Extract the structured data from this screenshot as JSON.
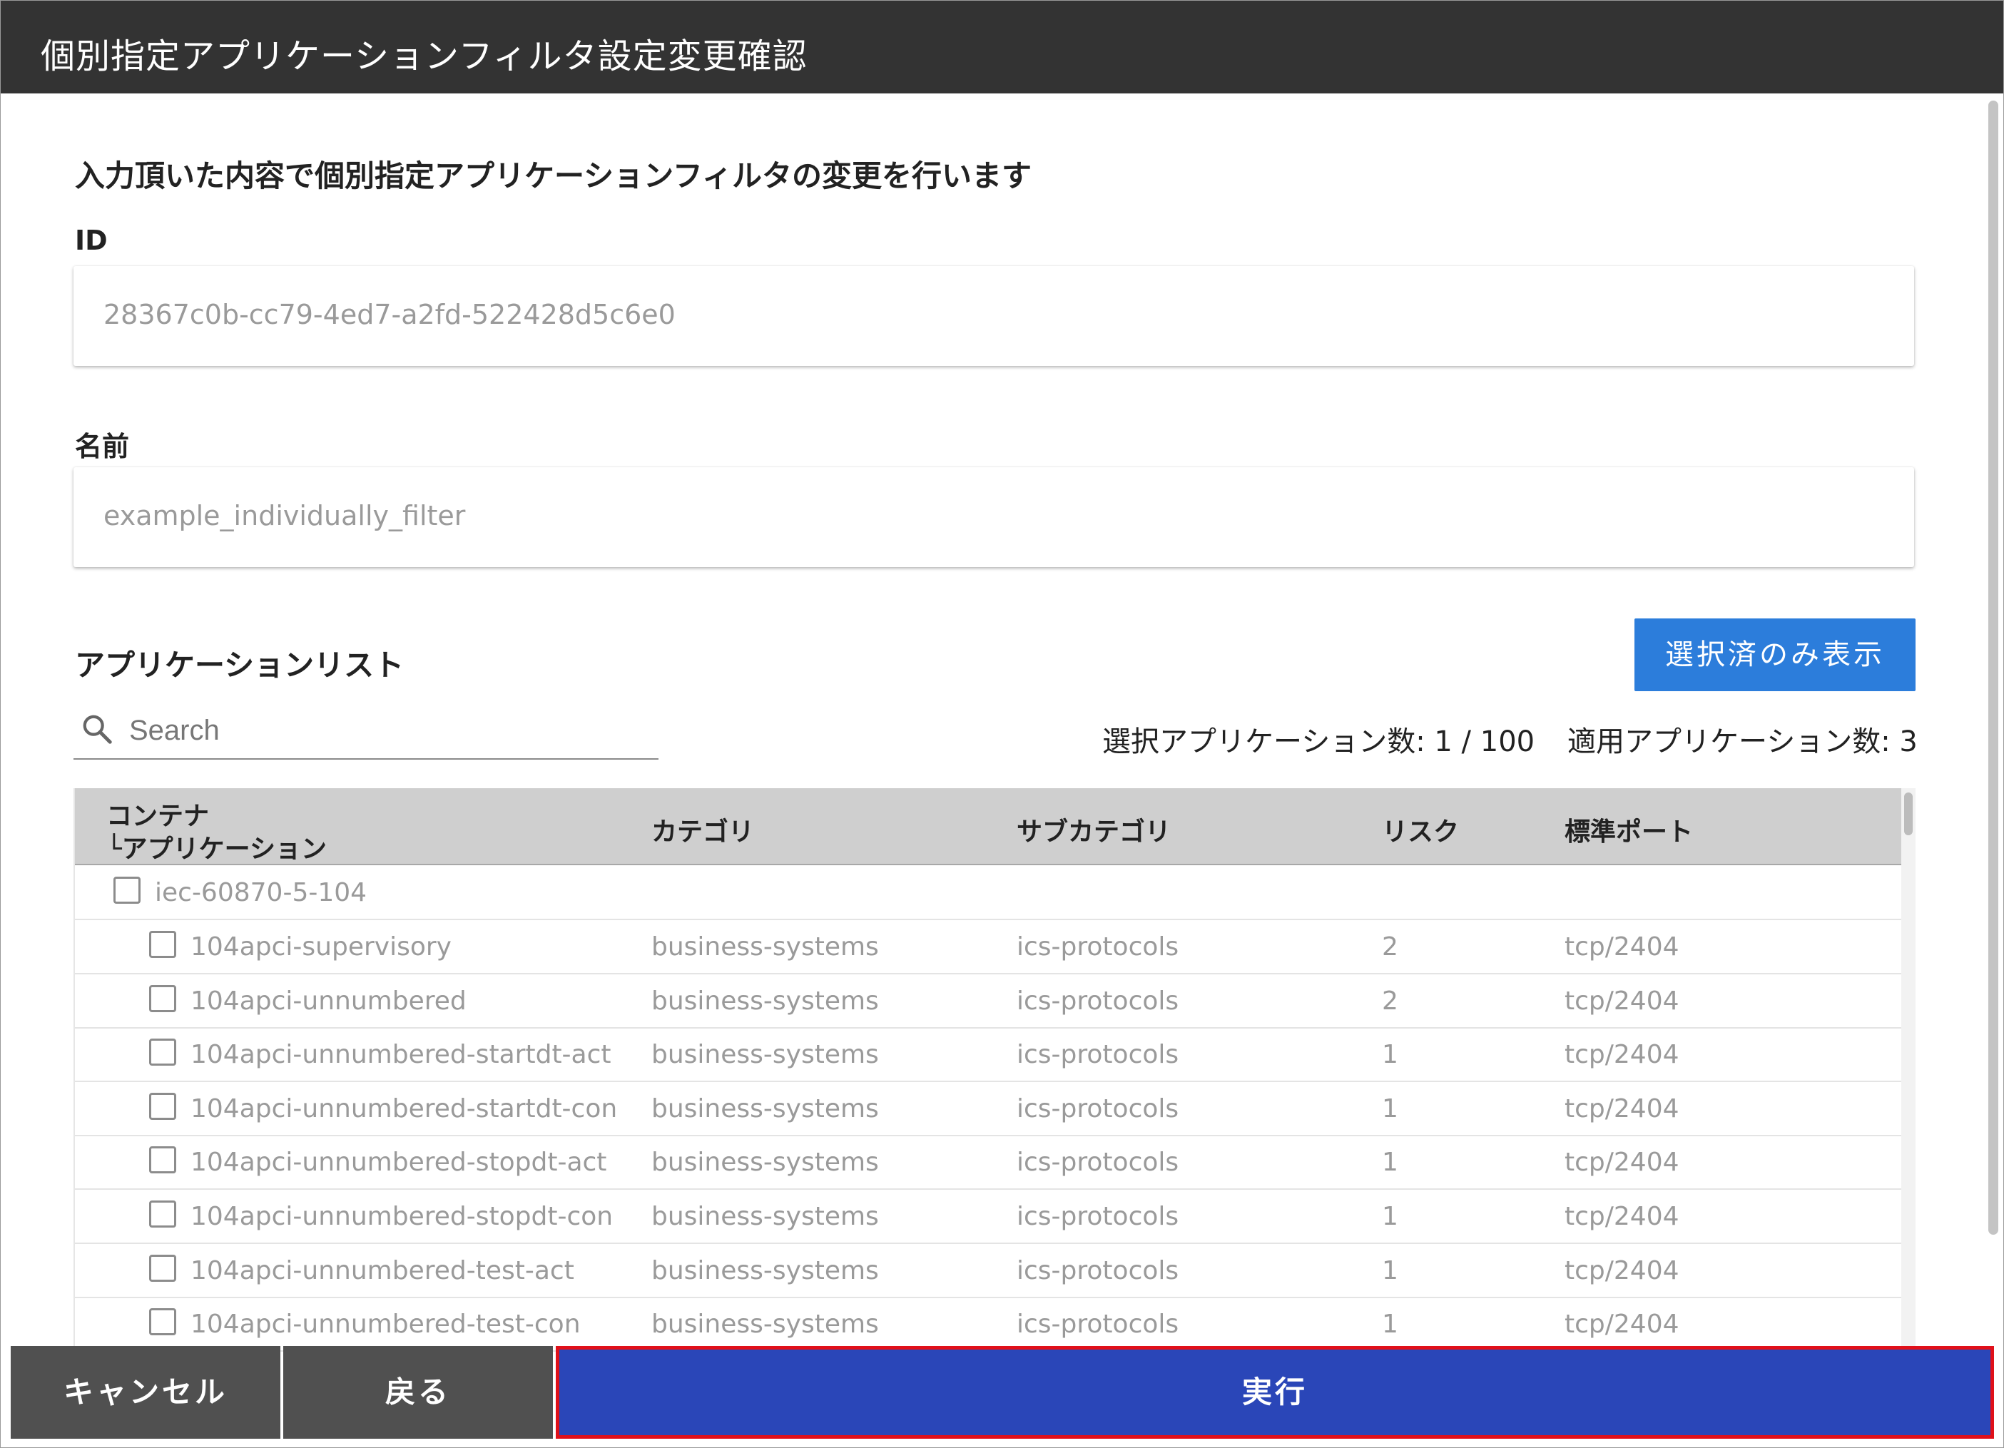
{
  "dialog": {
    "title": "個別指定アプリケーションフィルタ設定変更確認",
    "lead": "入力頂いた内容で個別指定アプリケーションフィルタの変更を行います"
  },
  "fields": {
    "id_label": "ID",
    "id_value": "28367c0b-cc79-4ed7-a2fd-522428d5c6e0",
    "name_label": "名前",
    "name_value": "example_individually_filter"
  },
  "app_list": {
    "title": "アプリケーションリスト",
    "selected_only_button": "選択済のみ表示",
    "search_placeholder": "Search",
    "selected_count": "選択アプリケーション数: 1 / 100",
    "applied_count": "適用アプリケーション数: 3",
    "columns": {
      "container_line1": "コンテナ",
      "container_line2": "└アプリケーション",
      "category": "カテゴリ",
      "subcategory": "サブカテゴリ",
      "risk": "リスク",
      "port": "標準ポート"
    },
    "container": {
      "name": "iec-60870-5-104",
      "checked": false
    },
    "rows": [
      {
        "name": "104apci-supervisory",
        "category": "business-systems",
        "subcategory": "ics-protocols",
        "risk": "2",
        "port": "tcp/2404",
        "checked": false
      },
      {
        "name": "104apci-unnumbered",
        "category": "business-systems",
        "subcategory": "ics-protocols",
        "risk": "2",
        "port": "tcp/2404",
        "checked": false
      },
      {
        "name": "104apci-unnumbered-startdt-act",
        "category": "business-systems",
        "subcategory": "ics-protocols",
        "risk": "1",
        "port": "tcp/2404",
        "checked": false
      },
      {
        "name": "104apci-unnumbered-startdt-con",
        "category": "business-systems",
        "subcategory": "ics-protocols",
        "risk": "1",
        "port": "tcp/2404",
        "checked": false
      },
      {
        "name": "104apci-unnumbered-stopdt-act",
        "category": "business-systems",
        "subcategory": "ics-protocols",
        "risk": "1",
        "port": "tcp/2404",
        "checked": false
      },
      {
        "name": "104apci-unnumbered-stopdt-con",
        "category": "business-systems",
        "subcategory": "ics-protocols",
        "risk": "1",
        "port": "tcp/2404",
        "checked": false
      },
      {
        "name": "104apci-unnumbered-test-act",
        "category": "business-systems",
        "subcategory": "ics-protocols",
        "risk": "1",
        "port": "tcp/2404",
        "checked": false
      },
      {
        "name": "104apci-unnumbered-test-con",
        "category": "business-systems",
        "subcategory": "ics-protocols",
        "risk": "1",
        "port": "tcp/2404",
        "checked": false
      }
    ]
  },
  "footer": {
    "cancel_label": "キャンセル",
    "back_label": "戻る",
    "execute_label": "実行"
  },
  "colors": {
    "titlebar": "#333333",
    "primary_button": "#2c7ddb",
    "execute_button": "#2a46b8",
    "highlight_border": "#e0101a",
    "secondary_button": "#505050"
  }
}
